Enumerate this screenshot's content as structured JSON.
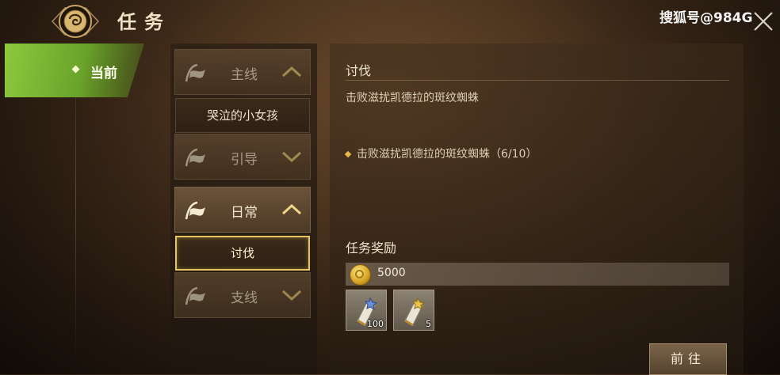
{
  "header": {
    "title": "任务",
    "watermark": "搜狐号@984G"
  },
  "category": {
    "current_label": "当前"
  },
  "quest_groups": [
    {
      "name": "主线",
      "expanded": true,
      "items": [
        "哭泣的小女孩"
      ]
    },
    {
      "name": "引导",
      "expanded": false,
      "items": []
    },
    {
      "name": "日常",
      "expanded": true,
      "items": [
        "讨伐"
      ]
    },
    {
      "name": "支线",
      "expanded": false,
      "items": []
    }
  ],
  "selected_quest": {
    "title": "讨伐",
    "description": "击败滋扰凯德拉的斑纹蜘蛛",
    "objective": "击败滋扰凯德拉的斑纹蜘蛛（6/10）"
  },
  "rewards": {
    "title": "任务奖励",
    "gold": "5000",
    "items": [
      {
        "icon": "scroll-item-icon",
        "quantity": "100"
      },
      {
        "icon": "scroll-item-icon",
        "quantity": "5"
      }
    ]
  },
  "actions": {
    "go_label": "前往"
  },
  "colors": {
    "accent_green": "#8cc93d",
    "selected_border": "#e6c560",
    "gold": "#d4a020"
  }
}
